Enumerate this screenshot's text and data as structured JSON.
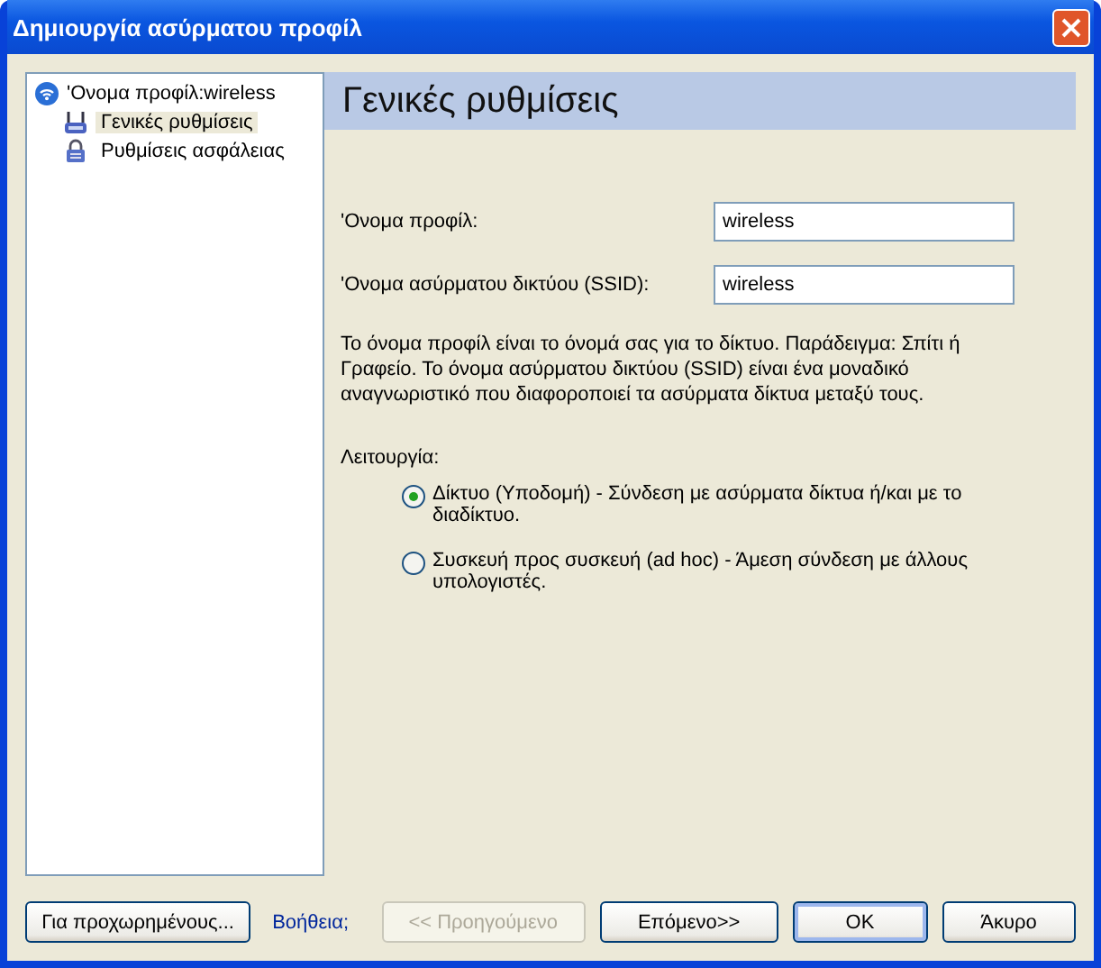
{
  "window": {
    "title": "Δημιουργία ασύρματου προφίλ"
  },
  "tree": {
    "label": "'Ονομα προφίλ:wireless",
    "children": [
      {
        "label": "Γενικές ρυθμίσεις",
        "kind": "network",
        "selected": true
      },
      {
        "label": "Ρυθμίσεις ασφάλειας",
        "kind": "lock",
        "selected": false
      }
    ]
  },
  "panel": {
    "heading": "Γενικές ρυθμίσεις",
    "fields": [
      {
        "label": "'Ονομα προφίλ:",
        "value": "wireless"
      },
      {
        "label": "'Ονομα ασύρματου δικτύου (SSID):",
        "value": "wireless"
      }
    ],
    "description": "Το όνομα προφίλ είναι το όνομά σας για το δίκτυο. Παράδειγμα: Σπίτι ή Γραφείο. Το όνομα ασύρματου δικτύου (SSID) είναι ένα μοναδικό αναγνωριστικό που διαφοροποιεί τα ασύρματα δίκτυα μεταξύ τους.",
    "mode_label": "Λειτουργία:",
    "modes": [
      {
        "label": "Δίκτυο (Υποδομή) - Σύνδεση με ασύρματα δίκτυα ή/και με το διαδίκτυο.",
        "selected": true
      },
      {
        "label": "Συσκευή προς συσκευή (ad hoc) - Άμεση σύνδεση με άλλους υπολογιστές.",
        "selected": false
      }
    ]
  },
  "footer": {
    "advanced": "Για προχωρημένους...",
    "help": "Βοήθεια;",
    "buttons": [
      {
        "label": "<< Προηγούμενο",
        "disabled": true,
        "default": false
      },
      {
        "label": "Επόμενο>>",
        "disabled": false,
        "default": false
      },
      {
        "label": "OK",
        "disabled": false,
        "default": true
      },
      {
        "label": "Άκυρο",
        "disabled": false,
        "default": false
      }
    ]
  }
}
